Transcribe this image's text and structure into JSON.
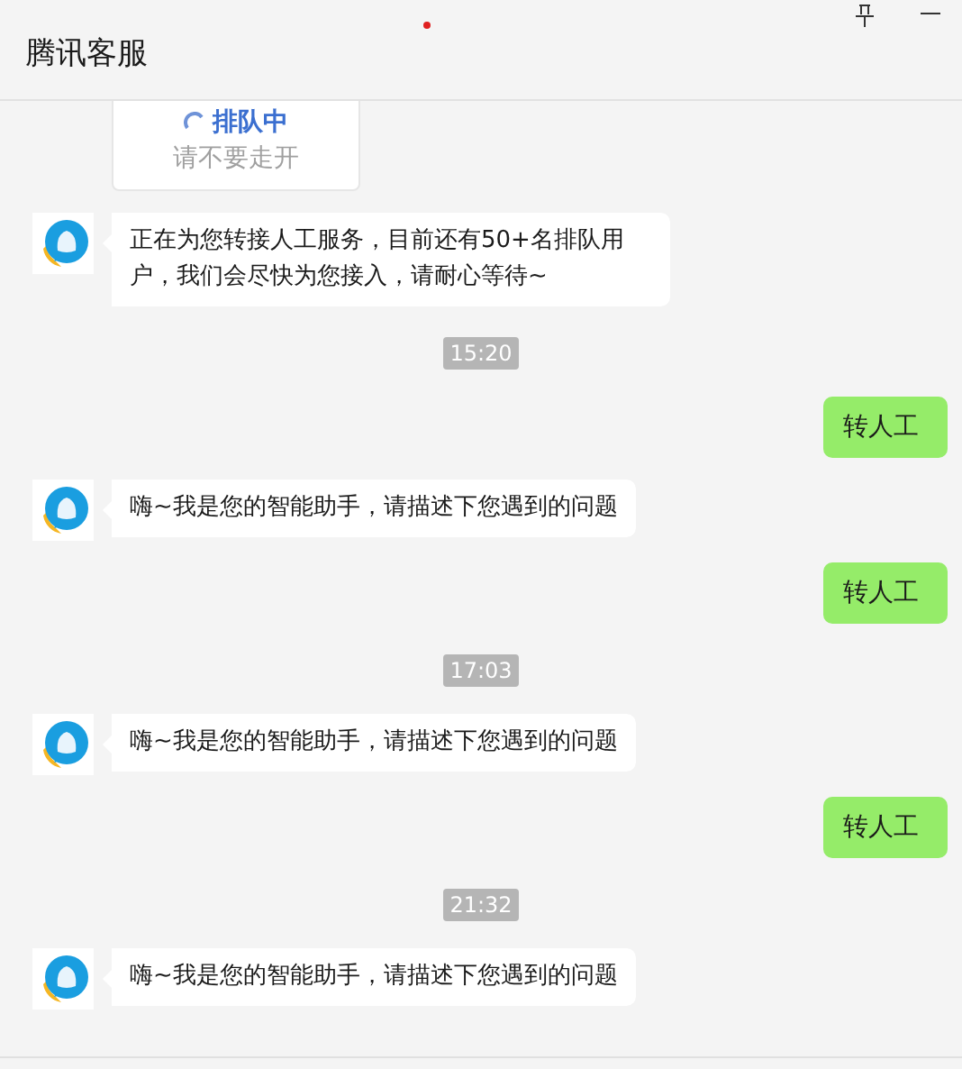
{
  "window": {
    "title": "腾讯客服"
  },
  "queue_card": {
    "status": "排队中",
    "note": "请不要走开"
  },
  "messages": [
    {
      "kind": "bot",
      "text": "正在为您转接人工服务，目前还有50+名排队用户，我们会尽快为您接入，请耐心等待~"
    },
    {
      "kind": "time",
      "text": "15:20"
    },
    {
      "kind": "user",
      "text": "转人工"
    },
    {
      "kind": "bot",
      "text": "嗨~我是您的智能助手，请描述下您遇到的问题"
    },
    {
      "kind": "user",
      "text": "转人工"
    },
    {
      "kind": "time",
      "text": "17:03"
    },
    {
      "kind": "bot",
      "text": "嗨~我是您的智能助手，请描述下您遇到的问题"
    },
    {
      "kind": "user",
      "text": "转人工"
    },
    {
      "kind": "time",
      "text": "21:32"
    },
    {
      "kind": "bot",
      "text": "嗨~我是您的智能助手，请描述下您遇到的问题"
    }
  ]
}
